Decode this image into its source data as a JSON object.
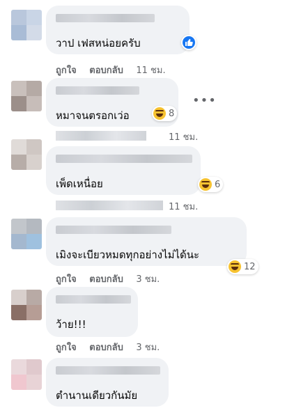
{
  "comments": [
    {
      "text": "วาป เฟสหน่อยครับ",
      "reaction": {
        "type": "like",
        "count": ""
      }
    },
    {
      "text": "หมาจนตรอกเว่อ",
      "reaction": {
        "type": "haha",
        "count": "8"
      }
    },
    {
      "text": "เพ็ดเหนื่อย",
      "reaction": {
        "type": "haha",
        "count": "6"
      }
    },
    {
      "text": "เมิงจะเบียวหมดทุกอย่างไม่ได้นะ",
      "reaction": {
        "type": "haha",
        "count": "12"
      }
    },
    {
      "text": "ว้าย!!!",
      "reaction": null
    },
    {
      "text": "ตำนานเดียวกันมัย",
      "reaction": null
    }
  ],
  "actions": {
    "like": "ถูกใจ",
    "reply": "ตอบกลับ"
  },
  "times": [
    "11 ชม.",
    "11 ชม.",
    "11 ชม.",
    "3 ชม.",
    "3 ชม."
  ],
  "more_icon": "more-options-icon"
}
